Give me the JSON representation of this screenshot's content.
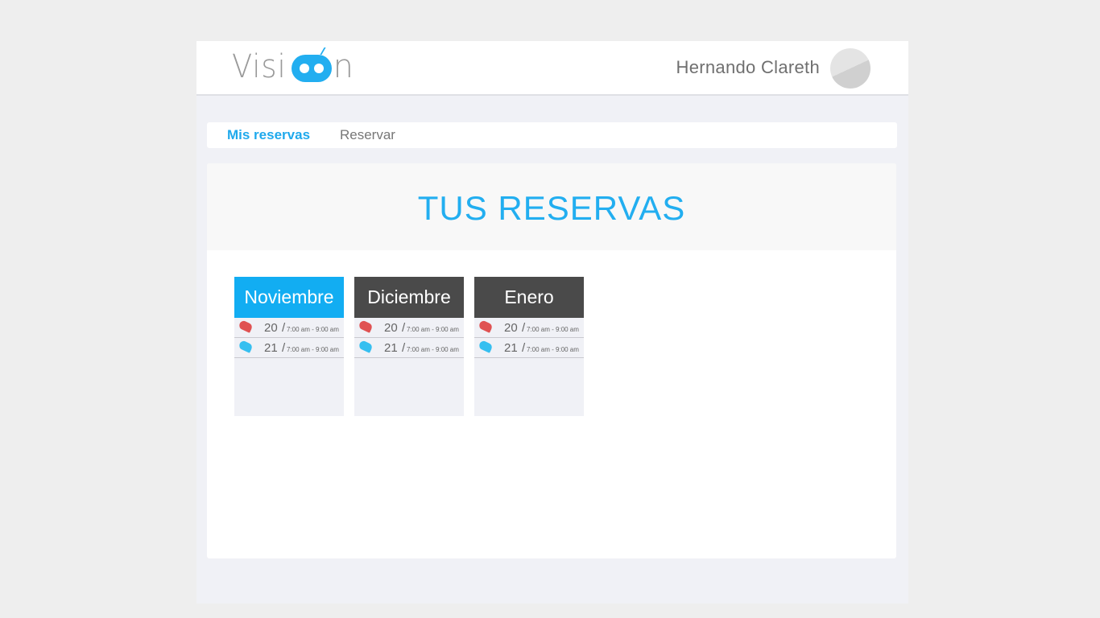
{
  "header": {
    "logo_text_left": "Visi",
    "logo_text_right": "n",
    "user_name": "Hernando Clareth"
  },
  "tabs": [
    {
      "label": "Mis reservas",
      "active": true
    },
    {
      "label": "Reservar",
      "active": false
    }
  ],
  "main": {
    "title": "TUS RESERVAS"
  },
  "colors": {
    "accent": "#1fa9ec",
    "dark_header": "#4a4a4a",
    "red_slot": "#e05252",
    "blue_slot": "#36bff0"
  },
  "months": [
    {
      "name": "Noviembre",
      "active": true,
      "slots": [
        {
          "day": "20",
          "sep": "/",
          "time": "7:00 am - 9:00 am",
          "icon": "red-half-circle-icon"
        },
        {
          "day": "21",
          "sep": "/",
          "time": "7:00 am - 9:00 am",
          "icon": "blue-half-circle-icon"
        }
      ]
    },
    {
      "name": "Diciembre",
      "active": false,
      "slots": [
        {
          "day": "20",
          "sep": "/",
          "time": "7:00 am - 9:00 am",
          "icon": "red-half-circle-icon"
        },
        {
          "day": "21",
          "sep": "/",
          "time": "7:00 am - 9:00 am",
          "icon": "blue-half-circle-icon"
        }
      ]
    },
    {
      "name": "Enero",
      "active": false,
      "slots": [
        {
          "day": "20",
          "sep": "/",
          "time": "7:00 am - 9:00 am",
          "icon": "red-half-circle-icon"
        },
        {
          "day": "21",
          "sep": "/",
          "time": "7:00 am - 9:00 am",
          "icon": "blue-half-circle-icon"
        }
      ]
    }
  ]
}
